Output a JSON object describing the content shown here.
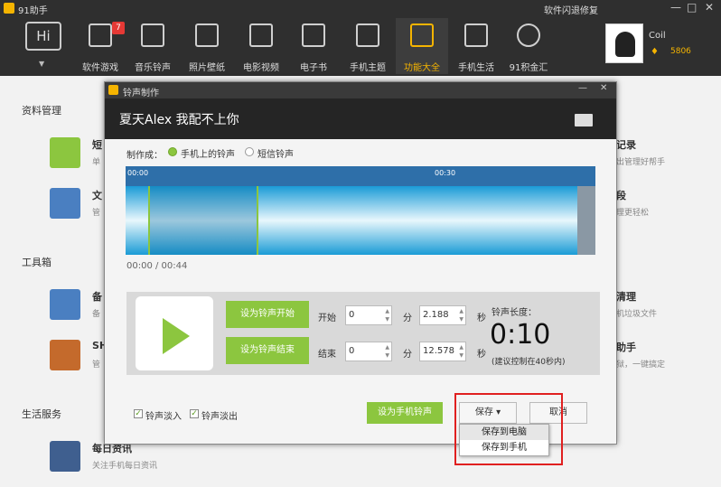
{
  "app": {
    "name": "91助手",
    "repair_label": "软件闪退修复",
    "min": "—",
    "max": "□",
    "close": "✕"
  },
  "nav": {
    "hi_label": "Hi",
    "items": [
      {
        "label": "软件游戏",
        "badge": "7"
      },
      {
        "label": "音乐铃声"
      },
      {
        "label": "照片壁纸"
      },
      {
        "label": "电影视频"
      },
      {
        "label": "电子书"
      },
      {
        "label": "手机主题"
      },
      {
        "label": "功能大全",
        "active": true
      },
      {
        "label": "手机生活"
      },
      {
        "label": "91积金汇"
      }
    ]
  },
  "user": {
    "name": "Coil",
    "coins": "5806"
  },
  "sections": {
    "data_mgmt": "资料管理",
    "toolbox": "工具箱",
    "life": "生活服务"
  },
  "features": {
    "sms_title": "短",
    "sms_sub": "单",
    "file_title": "文",
    "file_sub": "管",
    "backup_title": "备",
    "backup_sub": "备",
    "shsh_title": "SH",
    "shsh_sub": "管",
    "news_title": "每日资讯",
    "news_sub": "关注手机每日资讯",
    "right1_title": "记录",
    "right1_sub": "出管理好帮手",
    "right2_title": "段",
    "right2_sub": "理更轻松",
    "right3_title": "清理",
    "right3_sub": "机垃圾文件",
    "right4_title": "助手",
    "right4_sub": "狱，一键搞定"
  },
  "dialog": {
    "title": "铃声制作",
    "song": "夏天Alex  我配不上你",
    "made_as": "制作成：",
    "opt_phone": "手机上的铃声",
    "opt_sms": "短信铃声",
    "ruler_start": "00:00",
    "ruler_mid": "00:30",
    "time_readout": "00:00 / 00:44",
    "btn_set_start": "设为铃声开始",
    "btn_set_end": "设为铃声结束",
    "start_label": "开始",
    "end_label": "结束",
    "min_unit": "分",
    "sec_unit": "秒",
    "start_min": "0",
    "start_sec": "2.188",
    "end_min": "0",
    "end_sec": "12.578",
    "length_label": "铃声长度：",
    "length_value": "0:10",
    "length_hint": "(建议控制在40秒内)",
    "fade_in": "铃声淡入",
    "fade_out": "铃声淡出",
    "set_phone_ringtone": "设为手机铃声",
    "save": "保存",
    "cancel": "取消",
    "menu": [
      "保存到电脑",
      "保存到手机"
    ]
  },
  "colors": {
    "accent": "#8cc63f",
    "brand": "#f5b400",
    "wave_blue": "#2e6fa9",
    "highlight": "#e02020"
  }
}
